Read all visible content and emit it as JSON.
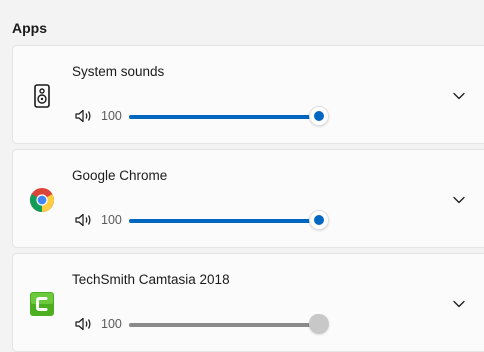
{
  "section_title": "Apps",
  "colors": {
    "accent": "#0067c0",
    "inactive": "#8a8a8a"
  },
  "apps": [
    {
      "name": "System sounds",
      "icon": "speaker-icon",
      "volume": 100,
      "volume_label": "100",
      "active": true
    },
    {
      "name": "Google Chrome",
      "icon": "chrome-icon",
      "volume": 100,
      "volume_label": "100",
      "active": true
    },
    {
      "name": "TechSmith Camtasia 2018",
      "icon": "camtasia-icon",
      "volume": 100,
      "volume_label": "100",
      "active": false
    }
  ]
}
